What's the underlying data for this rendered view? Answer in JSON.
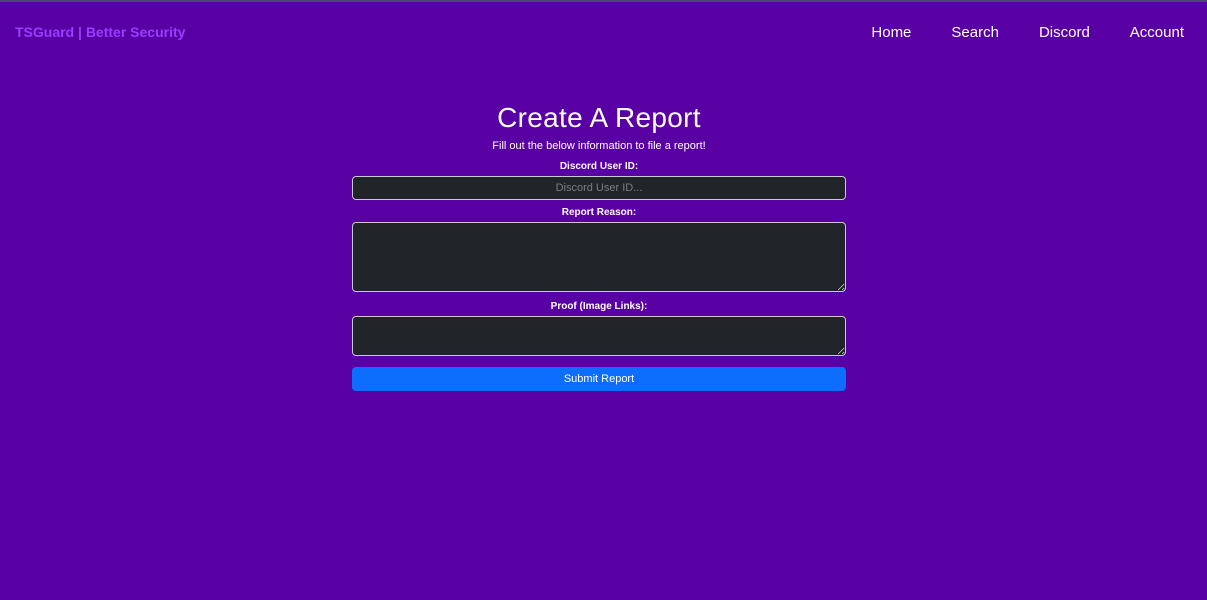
{
  "navbar": {
    "brand": "TSGuard | Better Security",
    "links": [
      {
        "label": "Home"
      },
      {
        "label": "Search"
      },
      {
        "label": "Discord"
      },
      {
        "label": "Account"
      }
    ]
  },
  "form": {
    "title": "Create A Report",
    "subtitle": "Fill out the below information to file a report!",
    "user_id": {
      "label": "Discord User ID:",
      "placeholder": "Discord User ID...",
      "value": ""
    },
    "reason": {
      "label": "Report Reason:",
      "value": ""
    },
    "proof": {
      "label": "Proof (Image Links):",
      "value": ""
    },
    "submit_label": "Submit Report"
  },
  "colors": {
    "background": "#5800a3",
    "brand": "#9b3dff",
    "input_bg": "#212529",
    "button": "#0d6efd"
  }
}
